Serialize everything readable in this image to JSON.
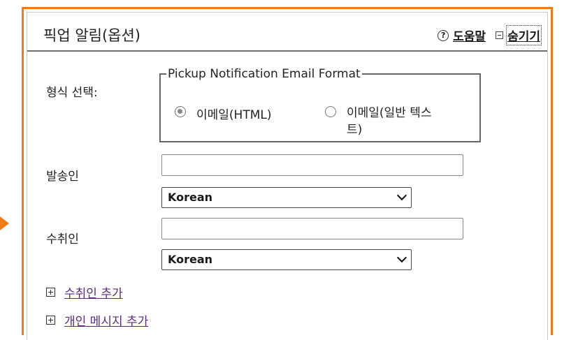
{
  "panel": {
    "title": "픽업 알림(옵션)",
    "help_label": "도움말",
    "hide_label": "숨기기",
    "accent_color": "#f07c18"
  },
  "format": {
    "label": "형식 선택:",
    "legend": "Pickup Notification Email Format",
    "options": [
      {
        "label": "이메일(HTML)",
        "checked": true
      },
      {
        "label_line1": "이메일(일반 텍스",
        "label_line2": "트)",
        "checked": false
      }
    ]
  },
  "sender": {
    "label": "발송인",
    "value": "",
    "language": "Korean"
  },
  "recipient": {
    "label": "수취인",
    "value": "",
    "language": "Korean"
  },
  "actions": {
    "add_recipient": "수취인 추가",
    "add_personal_message": "개인 메시지 추가"
  },
  "icons": {
    "help": "help-circle-icon",
    "collapse": "minus-box-icon",
    "expand": "plus-box-icon",
    "pointer": "arrow-right-icon"
  }
}
